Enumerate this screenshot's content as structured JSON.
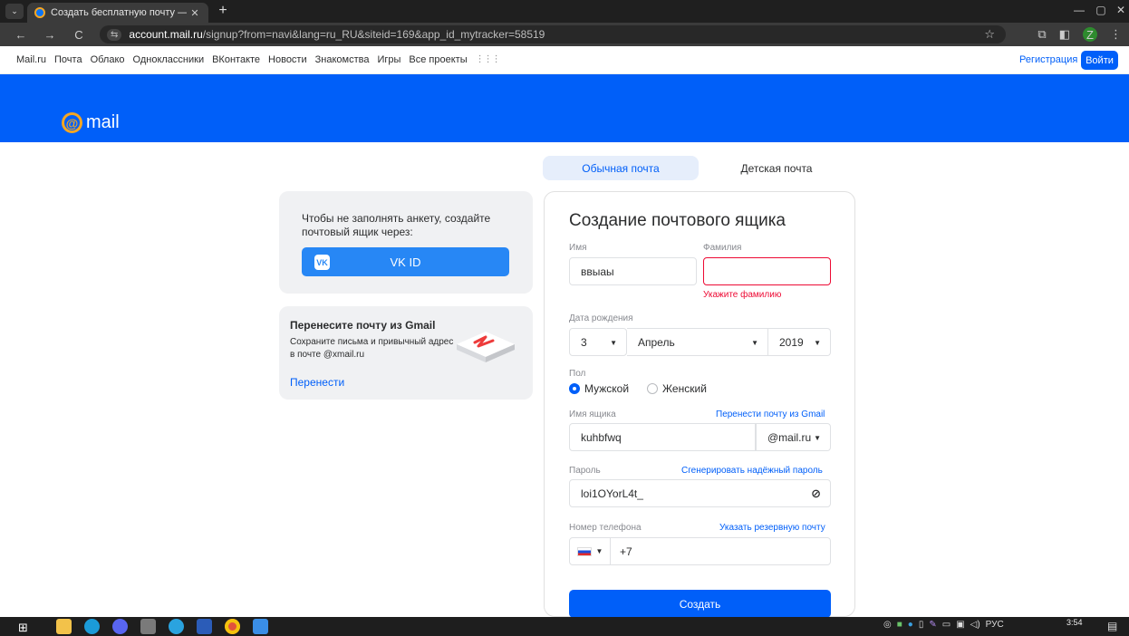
{
  "browser": {
    "tab_title": "Создать бесплатную почту —",
    "tab_close": "✕",
    "new_tab": "+",
    "url_host": "account.mail.ru",
    "url_rest": "/signup?from=navi&lang=ru_RU&siteid=169&app_id_mytracker=58519",
    "profile_letter": "Z",
    "window_controls": [
      "—",
      "▢",
      "✕"
    ]
  },
  "portal": {
    "links": [
      "Mail.ru",
      "Почта",
      "Облако",
      "Одноклассники",
      "ВКонтакте",
      "Новости",
      "Знакомства",
      "Игры",
      "Все проекты"
    ],
    "register": "Регистрация",
    "login": "Войти"
  },
  "header": {
    "logo_text": "mail"
  },
  "type_tabs": {
    "regular": "Обычная почта",
    "kids": "Детская почта"
  },
  "vk_card": {
    "text": "Чтобы не заполнять анкету, создайте почтовый ящик через:",
    "button": "VK ID"
  },
  "gmail_card": {
    "title": "Перенесите почту из Gmail",
    "description": "Сохраните письма и привычный адрес в почте @xmail.ru",
    "link": "Перенести"
  },
  "form": {
    "title": "Создание почтового ящика",
    "first_name_label": "Имя",
    "first_name_value": "ввыаы",
    "last_name_label": "Фамилия",
    "last_name_value": "",
    "last_name_error": "Укажите фамилию",
    "dob_label": "Дата рождения",
    "dob_day": "3",
    "dob_month": "Апрель",
    "dob_year": "2019",
    "gender_label": "Пол",
    "gender_male": "Мужской",
    "gender_female": "Женский",
    "mailbox_label": "Имя ящика",
    "mailbox_link": "Перенести почту из Gmail",
    "mailbox_value": "kuhbfwq",
    "mailbox_domain": "@mail.ru",
    "password_label": "Пароль",
    "password_link": "Сгенерировать надёжный пароль",
    "password_value": "loi1OYorL4t_",
    "phone_label": "Номер телефона",
    "phone_link": "Указать резервную почту",
    "phone_prefix": "+7",
    "submit": "Создать"
  },
  "taskbar": {
    "tray_lang": "РУС",
    "time": "3:54"
  },
  "colors": {
    "brand_blue": "#005ff9",
    "error_red": "#ed0a34",
    "vk_blue": "#2787f5"
  }
}
